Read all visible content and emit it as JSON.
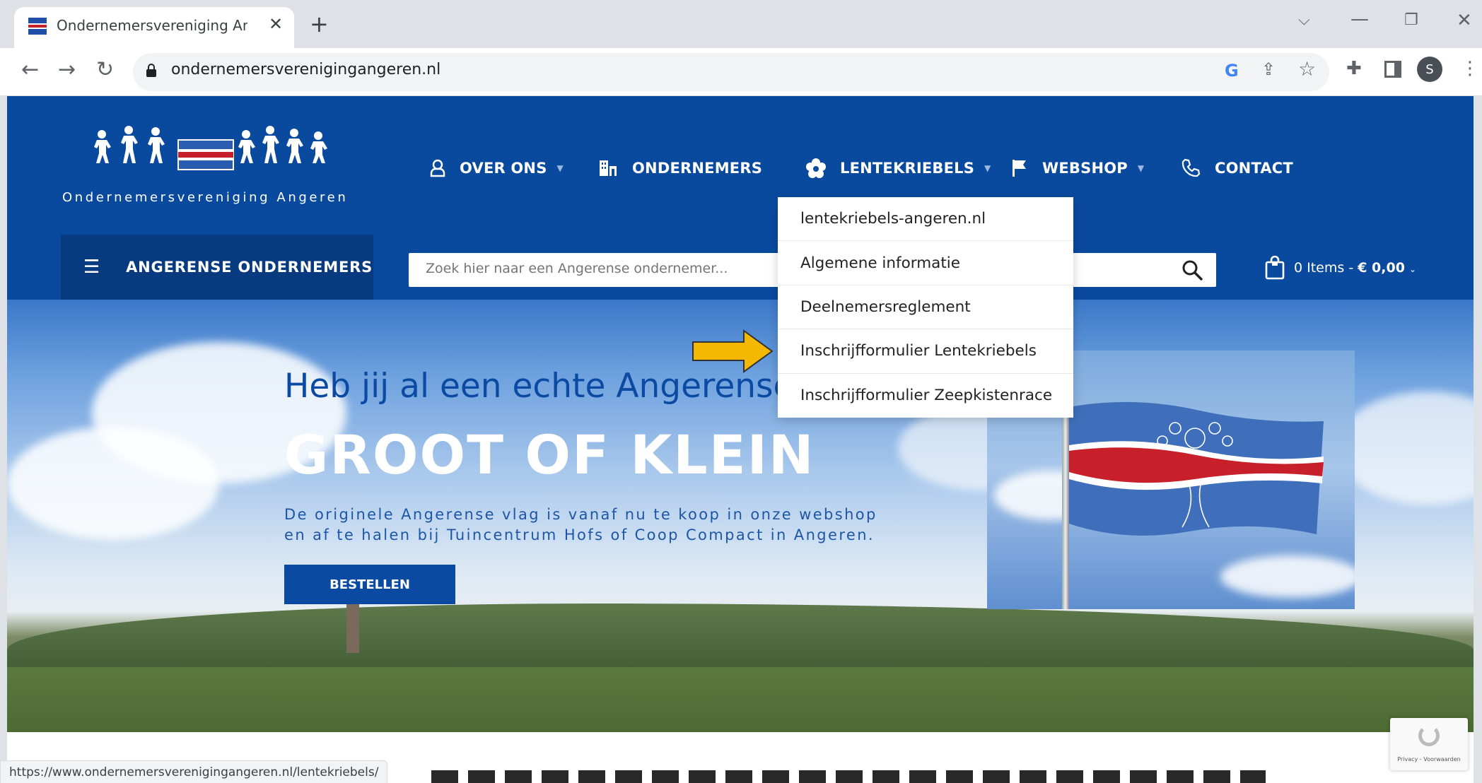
{
  "browser": {
    "tab_title": "Ondernemersvereniging Angere",
    "url": "ondernemersverenigingangeren.nl",
    "status_url": "https://www.ondernemersverenigingangeren.nl/lentekriebels/",
    "profile_initial": "S"
  },
  "site": {
    "logo_text": "Ondernemersvereniging Angeren",
    "nav": [
      {
        "label": "OVER ONS",
        "icon": "user-icon",
        "has_dropdown": true
      },
      {
        "label": "ONDERNEMERS",
        "icon": "building-icon",
        "has_dropdown": false
      },
      {
        "label": "LENTEKRIEBELS",
        "icon": "flower-icon",
        "has_dropdown": true
      },
      {
        "label": "WEBSHOP",
        "icon": "flag-icon",
        "has_dropdown": true
      },
      {
        "label": "CONTACT",
        "icon": "phone-icon",
        "has_dropdown": false
      }
    ],
    "category_label": "ANGERENSE ONDERNEMERS",
    "search_placeholder": "Zoek hier naar een Angerense ondernemer...",
    "cart_items": "0 Items - ",
    "cart_total": "€ 0,00"
  },
  "dropdown": {
    "items": [
      "lentekriebels-angeren.nl",
      "Algemene informatie",
      "Deelnemersreglement",
      "Inschrijfformulier Lentekriebels",
      "Inschrijfformulier Zeepkistenrace"
    ]
  },
  "hero": {
    "heading": "Heb jij al een echte Angerense",
    "title": "GROOT OF KLEIN",
    "description_line1": "De originele Angerense vlag is vanaf nu te koop in onze webshop",
    "description_line2": "en af te halen bij Tuincentrum Hofs of Coop Compact in Angeren.",
    "button_label": "BESTELLEN"
  },
  "recaptcha_text": "Privacy - Voorwaarden",
  "colors": {
    "brand_blue": "#0a4a9e",
    "dark_blue": "#083a80",
    "arrow_yellow": "#f5b800",
    "flag_red": "#c8202a"
  }
}
